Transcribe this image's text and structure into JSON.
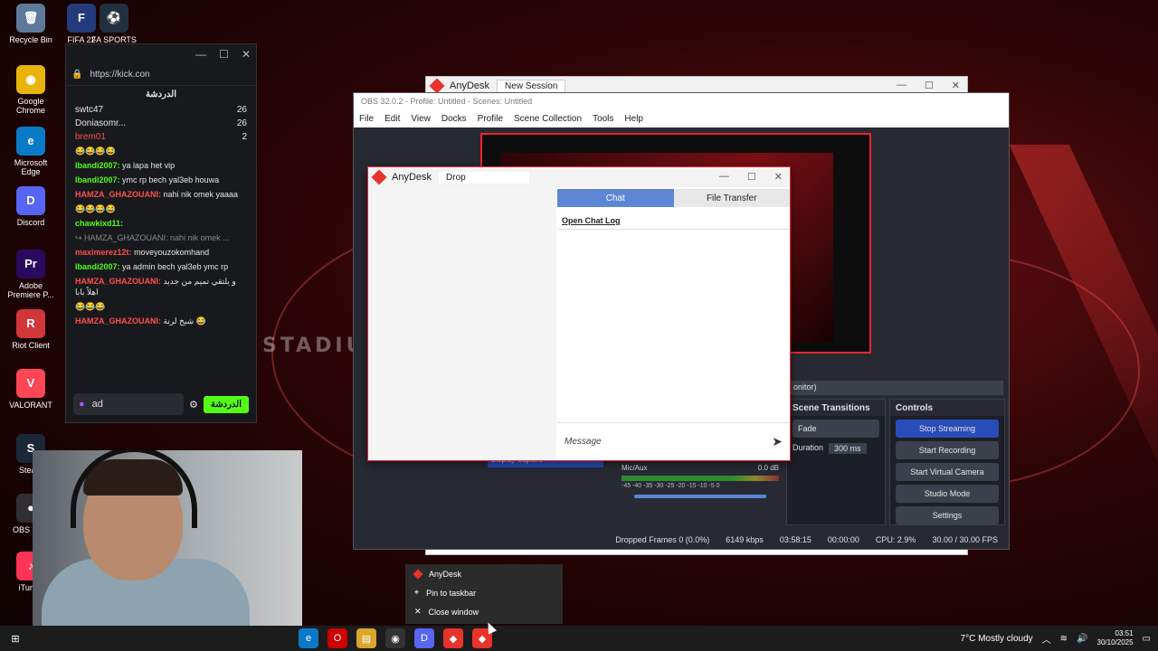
{
  "desktop": {
    "icons": [
      {
        "label": "Recycle Bin",
        "color": "#5d7a9a",
        "glyph": "🗑"
      },
      {
        "label": "FIFA 22",
        "color": "#233b7a",
        "glyph": "F"
      },
      {
        "label": "FA SPORTS",
        "color": "#203040",
        "glyph": "⚽"
      },
      {
        "label": "Google Chrome",
        "color": "#e8b30b",
        "glyph": "◉"
      },
      {
        "label": "Microsoft Edge",
        "color": "#0a7ac8",
        "glyph": "e"
      },
      {
        "label": "Discord",
        "color": "#5865f2",
        "glyph": "D"
      },
      {
        "label": "Adobe Premiere P...",
        "color": "#2a0a5e",
        "glyph": "Pr"
      },
      {
        "label": "Riot Client",
        "color": "#d13639",
        "glyph": "R"
      },
      {
        "label": "VALORANT",
        "color": "#ff4655",
        "glyph": "V"
      },
      {
        "label": "Steam",
        "color": "#1b2838",
        "glyph": "S"
      },
      {
        "label": "OBS Stud",
        "color": "#302e31",
        "glyph": "●"
      },
      {
        "label": "iTunes",
        "color": "#f35",
        "glyph": "♪"
      }
    ],
    "wallpaper_text": "STADIUM"
  },
  "kick_chat": {
    "url": "https://kick.con",
    "title": "الدردشة",
    "leaders": [
      {
        "name": "swtc47",
        "count": "26"
      },
      {
        "name": "Doniasomr...",
        "count": "26"
      },
      {
        "name": "brem01",
        "count": "2"
      }
    ],
    "messages": [
      {
        "user": "",
        "text": "😂😂😂😂",
        "color": "green"
      },
      {
        "user": "lbandi2007:",
        "text": "ya lapa het vip",
        "color": "green"
      },
      {
        "user": "lbandi2007:",
        "text": "ymc rp bech yal3eb houwa",
        "color": "green"
      },
      {
        "user": "HAMZA_GHAZOUANI:",
        "text": "nahi nik omek yaaaa",
        "color": "red"
      },
      {
        "user": "",
        "text": "😂😂😂😂",
        "color": "red"
      },
      {
        "user": "chawkixd11:",
        "text": "",
        "color": "green"
      },
      {
        "user": "",
        "text": "↪ HAMZA_GHAZOUANI: nahi nik omek ...",
        "color": "gray"
      },
      {
        "user": "maximerez12t:",
        "text": "moveyouzokomhand",
        "color": "red"
      },
      {
        "user": "lbandi2007:",
        "text": "ya admin bech yal3eb ymc rp",
        "color": "green"
      },
      {
        "user": "HAMZA_GHAZOUANI:",
        "text": "و يلتقي تميم من جديد اهلاً بابا",
        "color": "red"
      },
      {
        "user": "",
        "text": "😂😂😂",
        "color": "red"
      },
      {
        "user": "HAMZA_GHAZOUANI:",
        "text": "شيخ لرنة 😂",
        "color": "red"
      }
    ],
    "input_value": "ad",
    "send_label": "الدردشة"
  },
  "anydesk_back": {
    "app": "AnyDesk",
    "tab": "New Session"
  },
  "obs": {
    "title": "OBS 32.0.2 - Profile: Untitled - Scenes: Untitled",
    "menu": [
      "File",
      "Edit",
      "View",
      "Docks",
      "Profile",
      "Scene Collection",
      "Tools",
      "Help"
    ],
    "source_label": "Display Capture",
    "monitor_label": "onitor)",
    "transitions": {
      "title": "Scene Transitions",
      "type": "Fade",
      "duration_label": "Duration",
      "duration": "300 ms"
    },
    "mixer": {
      "channel": "Mic/Aux",
      "db": "0.0 dB",
      "scale": "-45 -40 -35 -30 -25 -20 -15 -10 -5 0"
    },
    "controls": {
      "title": "Controls",
      "buttons": [
        "Stop Streaming",
        "Start Recording",
        "Start Virtual Camera",
        "Studio Mode",
        "Settings"
      ]
    },
    "status": {
      "dropped": "Dropped Frames 0 (0.0%)",
      "bitrate": "6149 kbps",
      "live_time": "03:58:15",
      "rec_time": "00:00:00",
      "cpu": "CPU: 2.9%",
      "fps": "30.00 / 30.00 FPS"
    }
  },
  "anydesk_chat": {
    "app": "AnyDesk",
    "tab": "Drop",
    "tabs": [
      "Chat",
      "File Transfer"
    ],
    "open_log": "Open Chat Log",
    "message_placeholder": "Message"
  },
  "context_menu": {
    "items": [
      "AnyDesk",
      "Pin to taskbar",
      "Close window"
    ]
  },
  "taskbar": {
    "weather": "7°C  Mostly cloudy",
    "time": "03:51",
    "date": "30/10/2025"
  }
}
